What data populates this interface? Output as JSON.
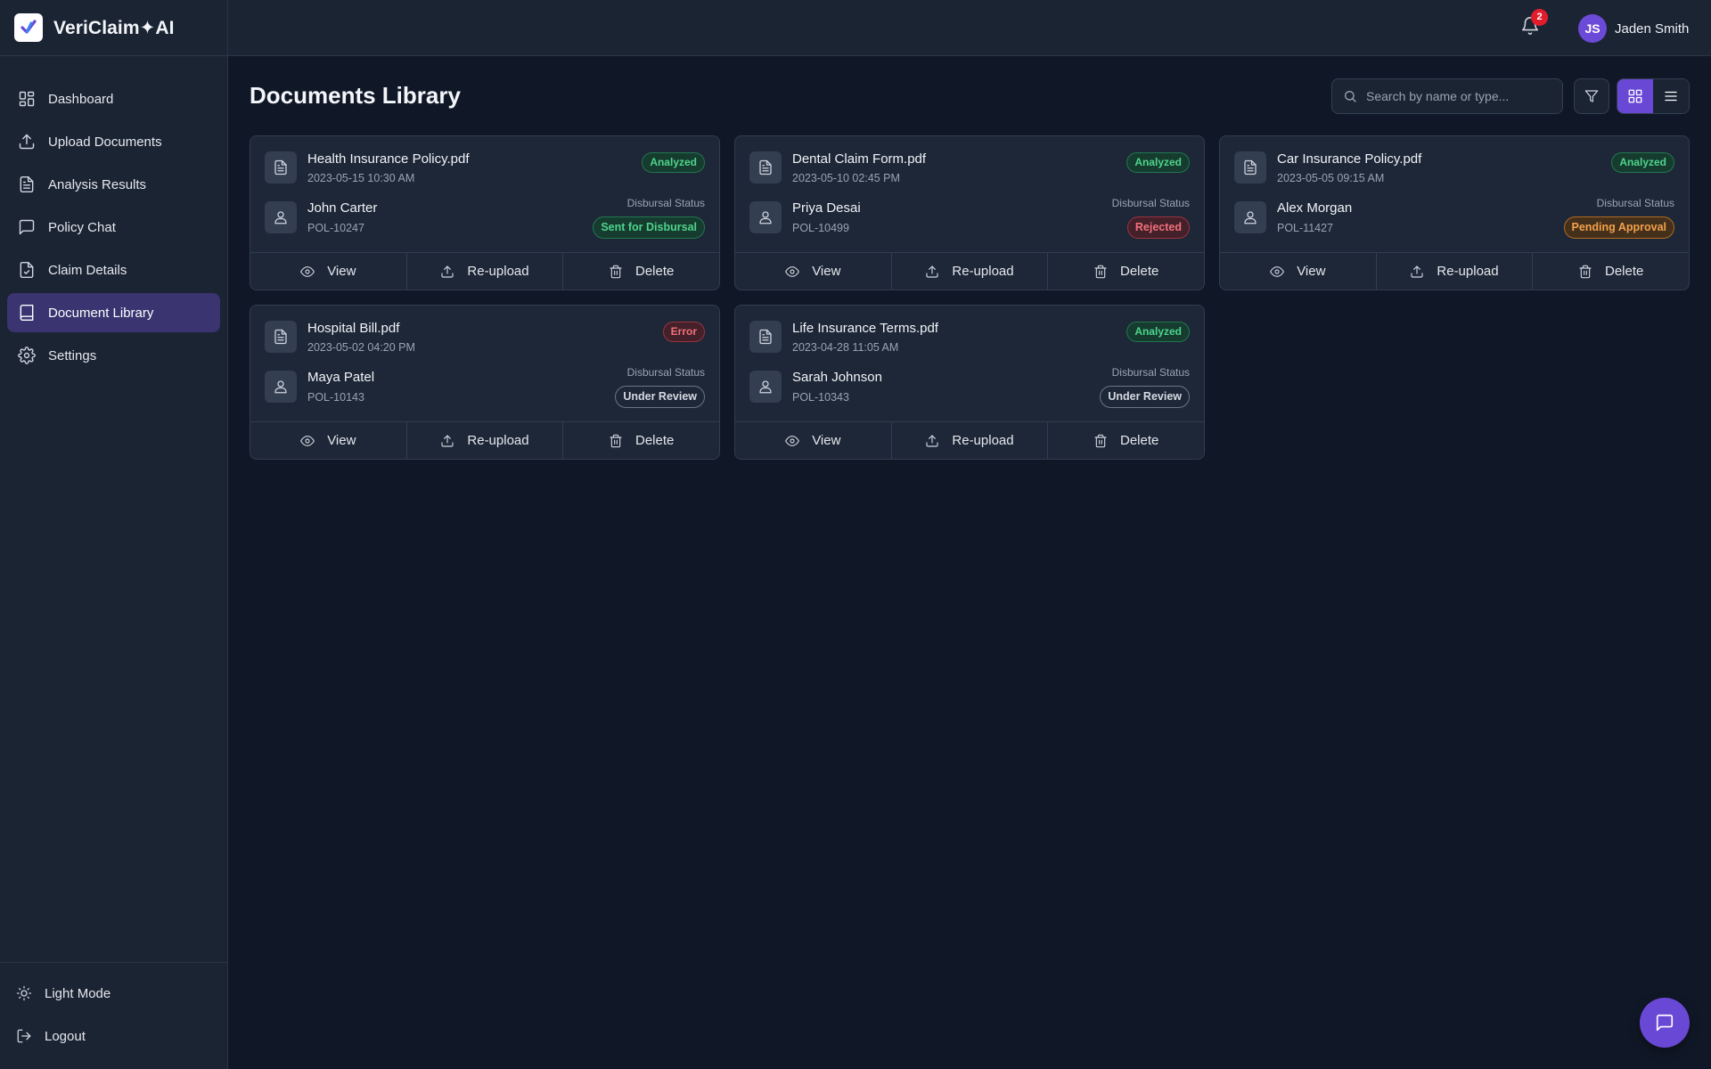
{
  "app": {
    "name": "VeriClaim✦AI",
    "logo_icon": "check-logo-icon"
  },
  "sidebar": {
    "items": [
      {
        "label": "Dashboard",
        "icon": "dashboard-icon"
      },
      {
        "label": "Upload Documents",
        "icon": "upload-icon"
      },
      {
        "label": "Analysis Results",
        "icon": "file-text-icon"
      },
      {
        "label": "Policy Chat",
        "icon": "chat-icon"
      },
      {
        "label": "Claim Details",
        "icon": "file-check-icon"
      },
      {
        "label": "Document Library",
        "icon": "book-icon",
        "active": true
      },
      {
        "label": "Settings",
        "icon": "gear-icon"
      }
    ],
    "bottom": [
      {
        "label": "Light Mode",
        "icon": "sun-icon"
      },
      {
        "label": "Logout",
        "icon": "logout-icon"
      }
    ]
  },
  "topbar": {
    "notification_count": "2",
    "user": {
      "initials": "JS",
      "name": "Jaden Smith"
    }
  },
  "main": {
    "title": "Documents Library",
    "search_placeholder": "Search by name or type...",
    "view_mode": "grid"
  },
  "labels": {
    "disbursal_status": "Disbursal Status",
    "view": "View",
    "reupload": "Re-upload",
    "delete": "Delete"
  },
  "documents": [
    {
      "name": "Health Insurance Policy.pdf",
      "date": "2023-05-15 10:30 AM",
      "status": "Analyzed",
      "person": "John Carter",
      "policy": "POL-10247",
      "disbursal": "Sent for Disbursal"
    },
    {
      "name": "Dental Claim Form.pdf",
      "date": "2023-05-10 02:45 PM",
      "status": "Analyzed",
      "person": "Priya Desai",
      "policy": "POL-10499",
      "disbursal": "Rejected"
    },
    {
      "name": "Car Insurance Policy.pdf",
      "date": "2023-05-05 09:15 AM",
      "status": "Analyzed",
      "person": "Alex Morgan",
      "policy": "POL-11427",
      "disbursal": "Pending Approval"
    },
    {
      "name": "Hospital Bill.pdf",
      "date": "2023-05-02 04:20 PM",
      "status": "Error",
      "person": "Maya Patel",
      "policy": "POL-10143",
      "disbursal": "Under Review"
    },
    {
      "name": "Life Insurance Terms.pdf",
      "date": "2023-04-28 11:05 AM",
      "status": "Analyzed",
      "person": "Sarah Johnson",
      "policy": "POL-10343",
      "disbursal": "Under Review"
    }
  ],
  "colors": {
    "accent": "#6a48d6",
    "analyzed": "#4ed48a",
    "error": "#f2717a",
    "pending": "#f2a14c",
    "review": "#d6dbe3"
  }
}
